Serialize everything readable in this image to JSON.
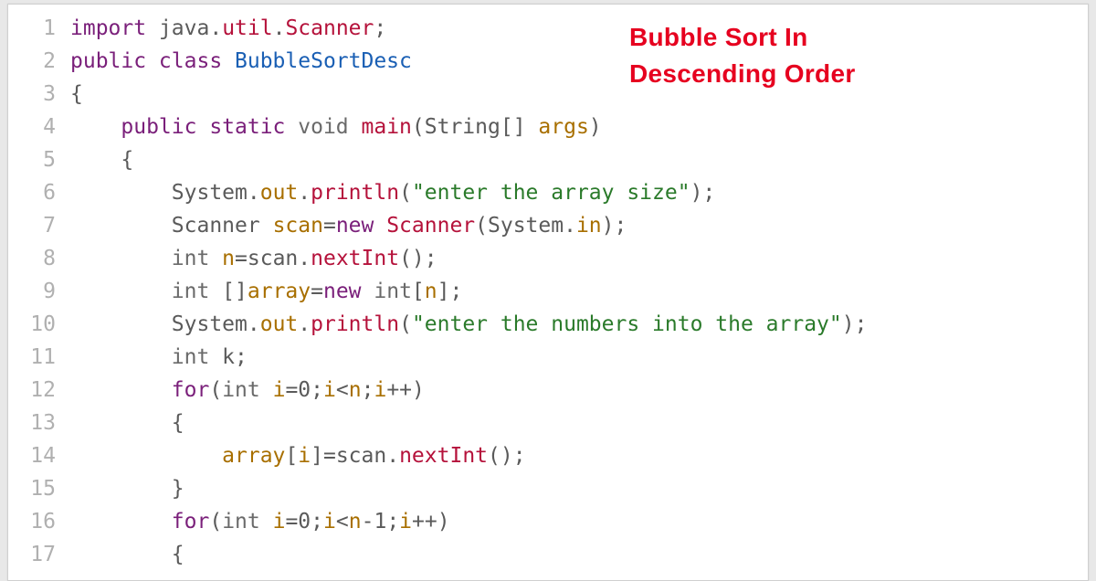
{
  "title_line1": "Bubble Sort In",
  "title_line2": "Descending Order",
  "lines": [
    {
      "n": "1",
      "tokens": [
        {
          "t": "import ",
          "c": "kw"
        },
        {
          "t": "java",
          "c": "obj"
        },
        {
          "t": ".",
          "c": "punc"
        },
        {
          "t": "util",
          "c": "call"
        },
        {
          "t": ".",
          "c": "punc"
        },
        {
          "t": "Scanner",
          "c": "call"
        },
        {
          "t": ";",
          "c": "punc"
        }
      ]
    },
    {
      "n": "2",
      "tokens": [
        {
          "t": "public class ",
          "c": "kw"
        },
        {
          "t": "BubbleSortDesc",
          "c": "name"
        }
      ]
    },
    {
      "n": "3",
      "tokens": [
        {
          "t": "{",
          "c": "punc"
        }
      ]
    },
    {
      "n": "4",
      "tokens": [
        {
          "t": "    ",
          "c": "punc"
        },
        {
          "t": "public static ",
          "c": "kw"
        },
        {
          "t": "void ",
          "c": "type"
        },
        {
          "t": "main",
          "c": "call"
        },
        {
          "t": "(",
          "c": "punc"
        },
        {
          "t": "String",
          "c": "obj"
        },
        {
          "t": "[] ",
          "c": "punc"
        },
        {
          "t": "args",
          "c": "var"
        },
        {
          "t": ")",
          "c": "punc"
        }
      ]
    },
    {
      "n": "5",
      "tokens": [
        {
          "t": "    {",
          "c": "punc"
        }
      ]
    },
    {
      "n": "6",
      "tokens": [
        {
          "t": "        ",
          "c": "punc"
        },
        {
          "t": "System",
          "c": "obj"
        },
        {
          "t": ".",
          "c": "punc"
        },
        {
          "t": "out",
          "c": "var"
        },
        {
          "t": ".",
          "c": "punc"
        },
        {
          "t": "println",
          "c": "call"
        },
        {
          "t": "(",
          "c": "punc"
        },
        {
          "t": "\"enter the array size\"",
          "c": "str"
        },
        {
          "t": ");",
          "c": "punc"
        }
      ]
    },
    {
      "n": "7",
      "tokens": [
        {
          "t": "        ",
          "c": "punc"
        },
        {
          "t": "Scanner ",
          "c": "obj"
        },
        {
          "t": "scan",
          "c": "var"
        },
        {
          "t": "=",
          "c": "punc"
        },
        {
          "t": "new ",
          "c": "kw"
        },
        {
          "t": "Scanner",
          "c": "call"
        },
        {
          "t": "(",
          "c": "punc"
        },
        {
          "t": "System",
          "c": "obj"
        },
        {
          "t": ".",
          "c": "punc"
        },
        {
          "t": "in",
          "c": "var"
        },
        {
          "t": ");",
          "c": "punc"
        }
      ]
    },
    {
      "n": "8",
      "tokens": [
        {
          "t": "        ",
          "c": "punc"
        },
        {
          "t": "int ",
          "c": "type"
        },
        {
          "t": "n",
          "c": "var"
        },
        {
          "t": "=scan.",
          "c": "punc"
        },
        {
          "t": "nextInt",
          "c": "call"
        },
        {
          "t": "();",
          "c": "punc"
        }
      ]
    },
    {
      "n": "9",
      "tokens": [
        {
          "t": "        ",
          "c": "punc"
        },
        {
          "t": "int ",
          "c": "type"
        },
        {
          "t": "[]",
          "c": "punc"
        },
        {
          "t": "array",
          "c": "var"
        },
        {
          "t": "=",
          "c": "punc"
        },
        {
          "t": "new ",
          "c": "kw"
        },
        {
          "t": "int",
          "c": "type"
        },
        {
          "t": "[",
          "c": "punc"
        },
        {
          "t": "n",
          "c": "var"
        },
        {
          "t": "];",
          "c": "punc"
        }
      ]
    },
    {
      "n": "10",
      "tokens": [
        {
          "t": "        ",
          "c": "punc"
        },
        {
          "t": "System",
          "c": "obj"
        },
        {
          "t": ".",
          "c": "punc"
        },
        {
          "t": "out",
          "c": "var"
        },
        {
          "t": ".",
          "c": "punc"
        },
        {
          "t": "println",
          "c": "call"
        },
        {
          "t": "(",
          "c": "punc"
        },
        {
          "t": "\"enter the numbers into the array\"",
          "c": "str"
        },
        {
          "t": ");",
          "c": "punc"
        }
      ]
    },
    {
      "n": "11",
      "tokens": [
        {
          "t": "        ",
          "c": "punc"
        },
        {
          "t": "int ",
          "c": "type"
        },
        {
          "t": "k;",
          "c": "punc"
        }
      ]
    },
    {
      "n": "12",
      "tokens": [
        {
          "t": "        ",
          "c": "punc"
        },
        {
          "t": "for",
          "c": "kw"
        },
        {
          "t": "(",
          "c": "punc"
        },
        {
          "t": "int ",
          "c": "type"
        },
        {
          "t": "i",
          "c": "var"
        },
        {
          "t": "=",
          "c": "punc"
        },
        {
          "t": "0",
          "c": "num"
        },
        {
          "t": ";",
          "c": "punc"
        },
        {
          "t": "i",
          "c": "var"
        },
        {
          "t": "<",
          "c": "punc"
        },
        {
          "t": "n",
          "c": "var"
        },
        {
          "t": ";",
          "c": "punc"
        },
        {
          "t": "i",
          "c": "var"
        },
        {
          "t": "++)",
          "c": "punc"
        }
      ]
    },
    {
      "n": "13",
      "tokens": [
        {
          "t": "        {",
          "c": "punc"
        }
      ]
    },
    {
      "n": "14",
      "tokens": [
        {
          "t": "            ",
          "c": "punc"
        },
        {
          "t": "array",
          "c": "var"
        },
        {
          "t": "[",
          "c": "punc"
        },
        {
          "t": "i",
          "c": "var"
        },
        {
          "t": "]=scan.",
          "c": "punc"
        },
        {
          "t": "nextInt",
          "c": "call"
        },
        {
          "t": "();",
          "c": "punc"
        }
      ]
    },
    {
      "n": "15",
      "tokens": [
        {
          "t": "        }",
          "c": "punc"
        }
      ]
    },
    {
      "n": "16",
      "tokens": [
        {
          "t": "        ",
          "c": "punc"
        },
        {
          "t": "for",
          "c": "kw"
        },
        {
          "t": "(",
          "c": "punc"
        },
        {
          "t": "int ",
          "c": "type"
        },
        {
          "t": "i",
          "c": "var"
        },
        {
          "t": "=",
          "c": "punc"
        },
        {
          "t": "0",
          "c": "num"
        },
        {
          "t": ";",
          "c": "punc"
        },
        {
          "t": "i",
          "c": "var"
        },
        {
          "t": "<",
          "c": "punc"
        },
        {
          "t": "n",
          "c": "var"
        },
        {
          "t": "-",
          "c": "punc"
        },
        {
          "t": "1",
          "c": "num"
        },
        {
          "t": ";",
          "c": "punc"
        },
        {
          "t": "i",
          "c": "var"
        },
        {
          "t": "++)",
          "c": "punc"
        }
      ]
    },
    {
      "n": "17",
      "tokens": [
        {
          "t": "        {",
          "c": "punc"
        }
      ]
    }
  ]
}
